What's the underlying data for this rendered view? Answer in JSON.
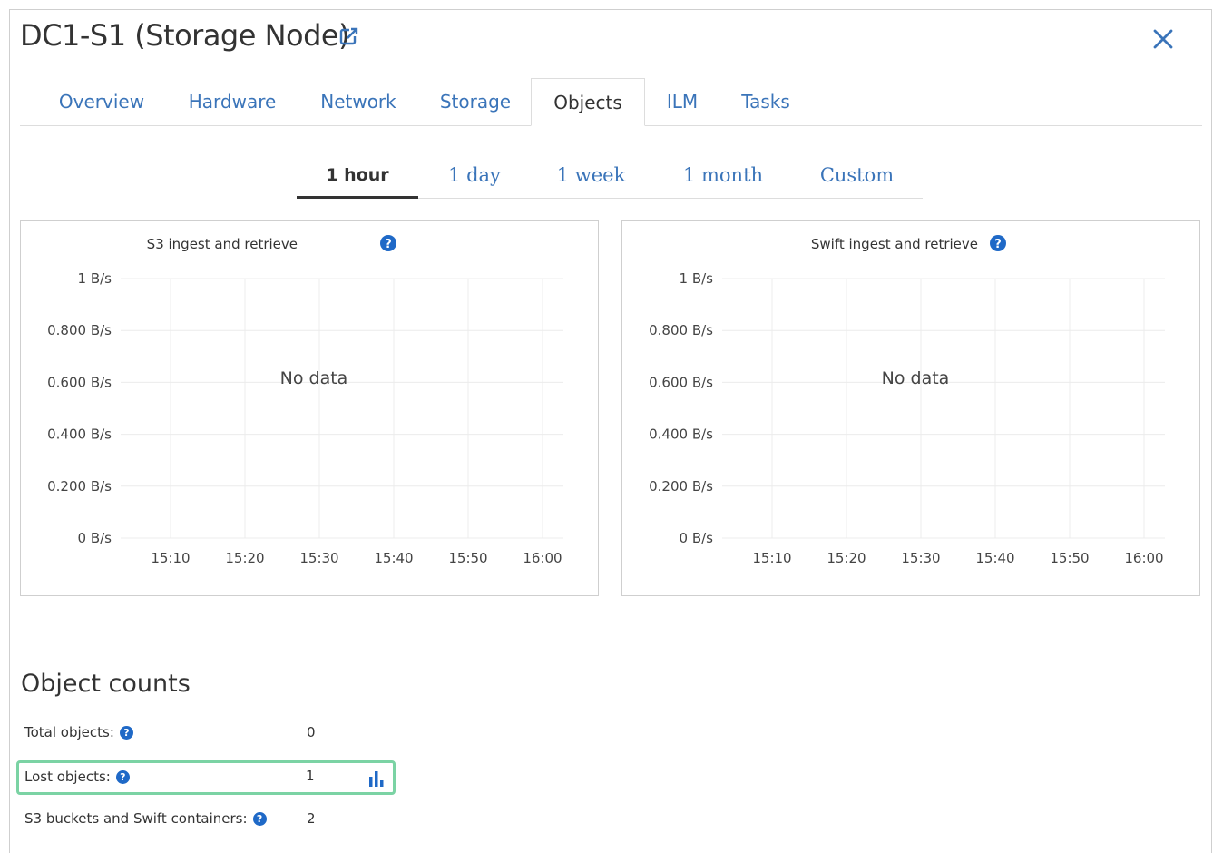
{
  "header": {
    "title": "DC1-S1 (Storage Node)",
    "external_link_icon": "external-link-icon",
    "close_icon": "close-icon"
  },
  "tabs": [
    {
      "label": "Overview",
      "active": false
    },
    {
      "label": "Hardware",
      "active": false
    },
    {
      "label": "Network",
      "active": false
    },
    {
      "label": "Storage",
      "active": false
    },
    {
      "label": "Objects",
      "active": true
    },
    {
      "label": "ILM",
      "active": false
    },
    {
      "label": "Tasks",
      "active": false
    }
  ],
  "periods": [
    {
      "label": "1 hour",
      "active": true
    },
    {
      "label": "1 day",
      "active": false
    },
    {
      "label": "1 week",
      "active": false
    },
    {
      "label": "1 month",
      "active": false
    },
    {
      "label": "Custom",
      "active": false
    }
  ],
  "charts": [
    {
      "title": "S3 ingest and retrieve",
      "no_data": "No data",
      "y_ticks": [
        "1 B/s",
        "0.800 B/s",
        "0.600 B/s",
        "0.400 B/s",
        "0.200 B/s",
        "0 B/s"
      ],
      "x_ticks": [
        "15:10",
        "15:20",
        "15:30",
        "15:40",
        "15:50",
        "16:00"
      ]
    },
    {
      "title": "Swift ingest and retrieve",
      "no_data": "No data",
      "y_ticks": [
        "1 B/s",
        "0.800 B/s",
        "0.600 B/s",
        "0.400 B/s",
        "0.200 B/s",
        "0 B/s"
      ],
      "x_ticks": [
        "15:10",
        "15:20",
        "15:30",
        "15:40",
        "15:50",
        "16:00"
      ]
    }
  ],
  "object_counts": {
    "title": "Object counts",
    "rows": [
      {
        "label": "Total objects:",
        "value": "0",
        "highlight": false,
        "has_chart": false
      },
      {
        "label": "Lost objects:",
        "value": "1",
        "highlight": true,
        "has_chart": true
      },
      {
        "label": "S3 buckets and Swift containers:",
        "value": "2",
        "highlight": false,
        "has_chart": false
      }
    ]
  },
  "colors": {
    "link": "#3a74b9",
    "help_icon": "#1f69c7",
    "highlight_border": "#7bd3a4"
  }
}
